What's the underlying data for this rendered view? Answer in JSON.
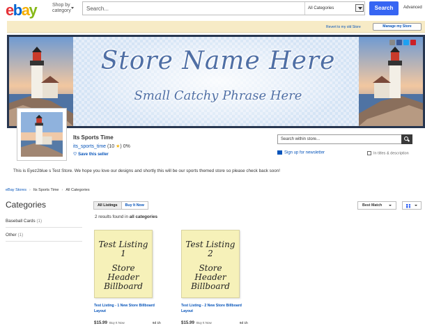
{
  "header": {
    "logo_letters": [
      "e",
      "b",
      "a",
      "y"
    ],
    "logo_colors": [
      "#e53238",
      "#0064d2",
      "#f5af02",
      "#86b817"
    ],
    "shop_by_line1": "Shop by",
    "shop_by_line2": "category",
    "search_placeholder": "Search...",
    "category_select": "All Categories",
    "search_button": "Search",
    "advanced_link": "Advanced"
  },
  "store_bar": {
    "revert_link": "Revert to my old Store",
    "manage_button": "Manage my Store"
  },
  "billboard": {
    "title": "Store Name Here",
    "tagline": "Small Catchy Phrase Here",
    "social_icons": [
      "email-icon",
      "facebook-icon",
      "twitter-icon",
      "pinterest-icon"
    ]
  },
  "store": {
    "name": "Its Sports Time",
    "username": "its_sports_time",
    "feedback_score": "(10",
    "feedback_star": "★",
    "feedback_close": ")",
    "feedback_percent": "0%",
    "save_link": "Save this seller",
    "search_placeholder": "Search within store...",
    "newsletter_link": "Sign up for newsletter",
    "in_titles_label": "In titles & description",
    "description": "This is Eyez2blue s Test Store. We hope you love our designs and shortly this will be our sports themed store so please check back soon!"
  },
  "breadcrumb": {
    "items": [
      "eBay Stores",
      "Its Sports Time",
      "All Categories"
    ],
    "separator": "›"
  },
  "sidebar": {
    "heading": "Categories",
    "items": [
      {
        "label": "Baseball Cards",
        "count": "(1)"
      },
      {
        "label": "Other",
        "count": "(1)"
      }
    ]
  },
  "listings": {
    "tabs": [
      "All Listings",
      "Buy It Now"
    ],
    "sort_label": "Best Match",
    "results_prefix": "2 results found in",
    "results_scope": "all categories",
    "items": [
      {
        "thumb_line1": "Test Listing 1",
        "thumb_line2": "Store Header Billboard",
        "title": "Test Listing - 1 New Store Billboard Layout",
        "price": "$15.99",
        "format": "Buy It Now",
        "time_left": "6d 1h"
      },
      {
        "thumb_line1": "Test Listing 2",
        "thumb_line2": "Store Header Billboard",
        "title": "Test Listing - 2 New Store Billboard Layout",
        "price": "$15.99",
        "format": "Buy It Now",
        "time_left": "6d 1h"
      }
    ]
  },
  "colors": {
    "link_blue": "#0654ba",
    "button_blue": "#3665f3",
    "store_bar_beige": "#f7ebc6",
    "billboard_border": "#27364f",
    "thumb_yellow": "#f6f1b9"
  }
}
